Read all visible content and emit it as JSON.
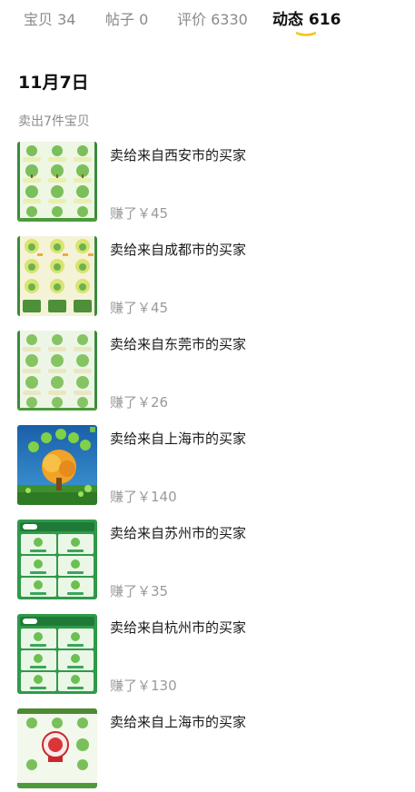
{
  "tabs": [
    {
      "label": "宝贝",
      "count": "34"
    },
    {
      "label": "帖子",
      "count": "0"
    },
    {
      "label": "评价",
      "count": "6330"
    },
    {
      "label": "动态",
      "count": "616"
    }
  ],
  "active_tab_color": "#f5c518",
  "date_heading": "11月7日",
  "sold_summary": "卖出7件宝贝",
  "sales": [
    {
      "title": "卖给来自西安市的买家",
      "earned": "赚了￥45",
      "thumb_style": "grid-a"
    },
    {
      "title": "卖给来自成都市的买家",
      "earned": "赚了￥45",
      "thumb_style": "grid-b"
    },
    {
      "title": "卖给来自东莞市的买家",
      "earned": "赚了￥26",
      "thumb_style": "grid-a"
    },
    {
      "title": "卖给来自上海市的买家",
      "earned": "赚了￥140",
      "thumb_style": "golden-tree"
    },
    {
      "title": "卖给来自苏州市的买家",
      "earned": "赚了￥35",
      "thumb_style": "app-green"
    },
    {
      "title": "卖给来自杭州市的买家",
      "earned": "赚了￥130",
      "thumb_style": "app-green"
    },
    {
      "title": "卖给来自上海市的买家",
      "earned": "",
      "thumb_style": "grid-stamp"
    }
  ]
}
